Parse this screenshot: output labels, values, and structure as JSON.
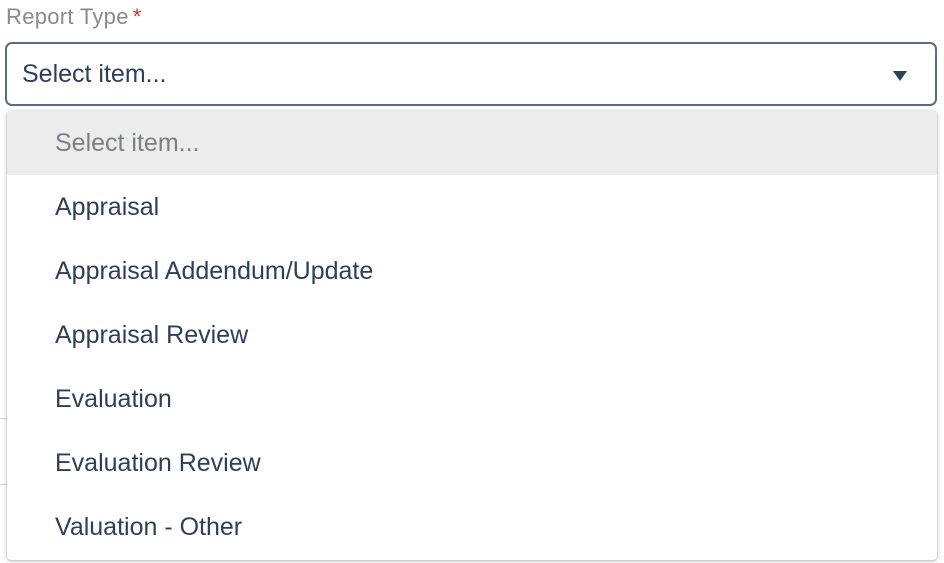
{
  "field": {
    "label": "Report Type",
    "required_mark": "*",
    "selected_value": "Select item...",
    "caret_icon": "caret-down-icon"
  },
  "dropdown": {
    "options": [
      {
        "label": "Select item...",
        "placeholder": true
      },
      {
        "label": "Appraisal"
      },
      {
        "label": "Appraisal Addendum/Update"
      },
      {
        "label": "Appraisal Review"
      },
      {
        "label": "Evaluation"
      },
      {
        "label": "Evaluation Review"
      },
      {
        "label": "Valuation - Other"
      }
    ]
  },
  "colors": {
    "text": "#2e3f58",
    "label": "#8a8a8a",
    "required": "#c0392b",
    "border": "#5a6b85",
    "highlight": "#ececec"
  }
}
